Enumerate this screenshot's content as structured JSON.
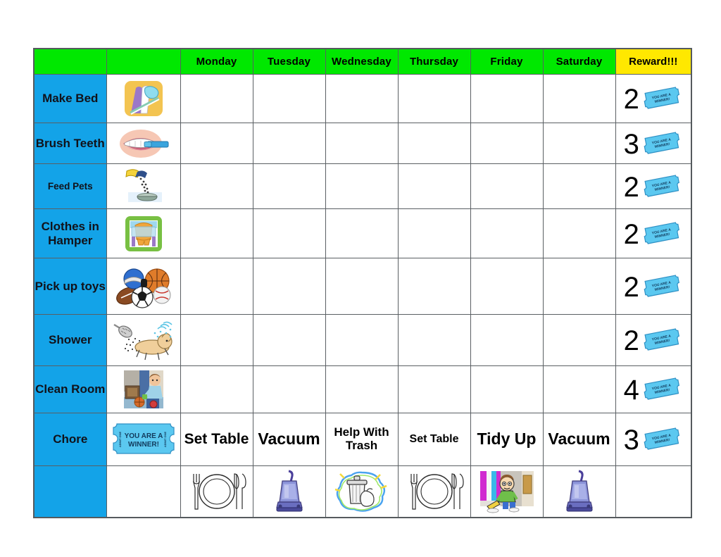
{
  "chart_data": {
    "type": "table",
    "title": "Weekly Chore Chart",
    "columns": [
      "",
      "",
      "Monday",
      "Tuesday",
      "Wednesday",
      "Thursday",
      "Friday",
      "Saturday",
      "Reward!!!"
    ],
    "rows": [
      {
        "chore": "Make Bed",
        "picture": "bed-pillow-icon",
        "monday": "",
        "tuesday": "",
        "wednesday": "",
        "thursday": "",
        "friday": "",
        "saturday": "",
        "reward": "2"
      },
      {
        "chore": "Brush Teeth",
        "picture": "toothbrush-mouth-icon",
        "monday": "",
        "tuesday": "",
        "wednesday": "",
        "thursday": "",
        "friday": "",
        "saturday": "",
        "reward": "3"
      },
      {
        "chore": "Feed Pets",
        "picture": "pet-food-bowl-icon",
        "monday": "",
        "tuesday": "",
        "wednesday": "",
        "thursday": "",
        "friday": "",
        "saturday": "",
        "reward": "2"
      },
      {
        "chore": "Clothes in Hamper",
        "picture": "laundry-hamper-icon",
        "monday": "",
        "tuesday": "",
        "wednesday": "",
        "thursday": "",
        "friday": "",
        "saturday": "",
        "reward": "2"
      },
      {
        "chore": "Pick up toys",
        "picture": "sports-balls-icon",
        "monday": "",
        "tuesday": "",
        "wednesday": "",
        "thursday": "",
        "friday": "",
        "saturday": "",
        "reward": "2"
      },
      {
        "chore": "Shower",
        "picture": "showerhead-icon",
        "monday": "",
        "tuesday": "",
        "wednesday": "",
        "thursday": "",
        "friday": "",
        "saturday": "",
        "reward": "2"
      },
      {
        "chore": "Clean Room",
        "picture": "child-cleaning-icon",
        "monday": "",
        "tuesday": "",
        "wednesday": "",
        "thursday": "",
        "friday": "",
        "saturday": "",
        "reward": "4"
      },
      {
        "chore": "Chore",
        "picture": "winner-ticket-icon",
        "monday": "Set Table",
        "tuesday": "Vacuum",
        "wednesday": "Help With Trash",
        "thursday": "Set Table",
        "friday": "Tidy Up",
        "saturday": "Vacuum",
        "reward": "3"
      },
      {
        "chore": "",
        "picture": "",
        "monday": "place-setting-icon",
        "tuesday": "vacuum-cleaner-icon",
        "wednesday": "trash-bag-icon",
        "thursday": "place-setting-icon",
        "friday": "child-sweeping-icon",
        "saturday": "vacuum-cleaner-icon",
        "reward": ""
      }
    ],
    "colors": {
      "header_green": "#00E800",
      "header_yellow": "#FFE800",
      "label_blue": "#13A3E8",
      "cell_white": "#FFFFFF",
      "border_gray": "#5A5F63",
      "ticket_blue": "#5BC8F0"
    }
  },
  "header": {
    "corner_blank_1": "",
    "corner_blank_2": "",
    "monday": "Monday",
    "tuesday": "Tuesday",
    "wednesday": "Wednesday",
    "thursday": "Thursday",
    "friday": "Friday",
    "saturday": "Saturday",
    "reward": "Reward!!!"
  },
  "chores": {
    "make_bed": "Make Bed",
    "brush_teeth": "Brush Teeth",
    "feed_pets": "Feed Pets",
    "clothes_in_hamper": "Clothes in Hamper",
    "pick_up_toys": "Pick up toys",
    "shower": "Shower",
    "clean_room": "Clean Room",
    "chore": "Chore",
    "blank": ""
  },
  "rewards": {
    "make_bed": "2",
    "brush_teeth": "3",
    "feed_pets": "2",
    "clothes_in_hamper": "2",
    "pick_up_toys": "2",
    "shower": "2",
    "clean_room": "4",
    "chore": "3"
  },
  "chore_row": {
    "monday": "Set Table",
    "tuesday": "Vacuum",
    "wednesday": "Help With Trash",
    "thursday": "Set Table",
    "friday": "Tidy Up",
    "saturday": "Vacuum"
  },
  "ticket": {
    "line1": "YOU ARE A",
    "line2": "WINNER!"
  }
}
